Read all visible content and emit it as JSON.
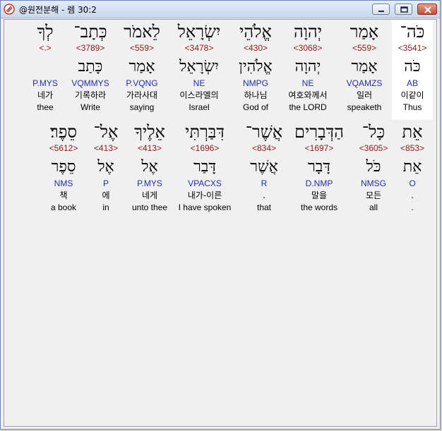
{
  "window": {
    "title": "@원전분해 - 렘 30:2"
  },
  "rows": [
    {
      "words": [
        {
          "heb": "כֹּה־",
          "strong": "<3541>",
          "lemma": "כֹּה",
          "morph": "AB",
          "kor": "이같이",
          "eng": "Thus",
          "highlight": true
        },
        {
          "heb": "אָמַר",
          "strong": "<559>",
          "lemma": "אָמַר",
          "morph": "VQAMZS",
          "kor": "일러",
          "eng": "speaketh"
        },
        {
          "heb": "יְהוָה",
          "strong": "<3068>",
          "lemma": "יְהוָה",
          "morph": "NE",
          "kor": "여호와께서",
          "eng": "the LORD"
        },
        {
          "heb": "אֱלֹהֵי",
          "strong": "<430>",
          "lemma": "אֱלֹהִין",
          "morph": "NMPG",
          "kor": "하나님",
          "eng": "God of"
        },
        {
          "heb": "יִשְׂרָאֵל",
          "strong": "<3478>",
          "lemma": "יִשְׂרָאֵל",
          "morph": "NE",
          "kor": "이스라엘의",
          "eng": "Israel"
        },
        {
          "heb": "לֵאמֹר",
          "strong": "<559>",
          "lemma": "אָמַר",
          "morph": "P.VQNG",
          "kor": "가라사대",
          "eng": "saying"
        },
        {
          "heb": "כְּתָב־",
          "strong": "<3789>",
          "lemma": "כָּתַב",
          "morph": "VQMMYS",
          "kor": "기록하라",
          "eng": "Write"
        },
        {
          "heb": "לְךָ",
          "strong": "<.>",
          "lemma": "",
          "morph": "P.MYS",
          "kor": "네가",
          "eng": "thee"
        }
      ]
    },
    {
      "words": [
        {
          "heb": "אֵת",
          "strong": "<853>",
          "lemma": "אֵת",
          "morph": "O",
          "kor": ".",
          "eng": "."
        },
        {
          "heb": "כָּל־",
          "strong": "<3605>",
          "lemma": "כֹּל",
          "morph": "NMSG",
          "kor": "모든",
          "eng": "all"
        },
        {
          "heb": "הַדְּבָרִים",
          "strong": "<1697>",
          "lemma": "דָּבָר",
          "morph": "D.NMP",
          "kor": "말을",
          "eng": "the words"
        },
        {
          "heb": "אֲשֶׁר־",
          "strong": "<834>",
          "lemma": "אֲשֶׁר",
          "morph": "R",
          "kor": ".",
          "eng": "that"
        },
        {
          "heb": "דִּבַּרְתִּי",
          "strong": "<1696>",
          "lemma": "דָּבַר",
          "morph": "VPACXS",
          "kor": "내가-이른",
          "eng": "I have spoken"
        },
        {
          "heb": "אֵלֶיךָ",
          "strong": "<413>",
          "lemma": "אֶל",
          "morph": "P.MYS",
          "kor": "네게",
          "eng": "unto thee"
        },
        {
          "heb": "אֶל־",
          "strong": "<413>",
          "lemma": "אֶל",
          "morph": "P",
          "kor": "에",
          "eng": "in"
        },
        {
          "heb": "סֵפֶר׃",
          "strong": "<5612>",
          "lemma": "סֵפֶר",
          "morph": "NMS",
          "kor": "책",
          "eng": "a book"
        }
      ]
    }
  ],
  "colors": {
    "strong": "#8b1a1a",
    "morph": "#1f2fa8",
    "highlight": "#ffffff",
    "background": "#f0f0f0"
  },
  "icons": {
    "app": "app-logo-icon",
    "minimize": "minimize-icon",
    "maximize": "maximize-icon",
    "close": "close-icon"
  }
}
